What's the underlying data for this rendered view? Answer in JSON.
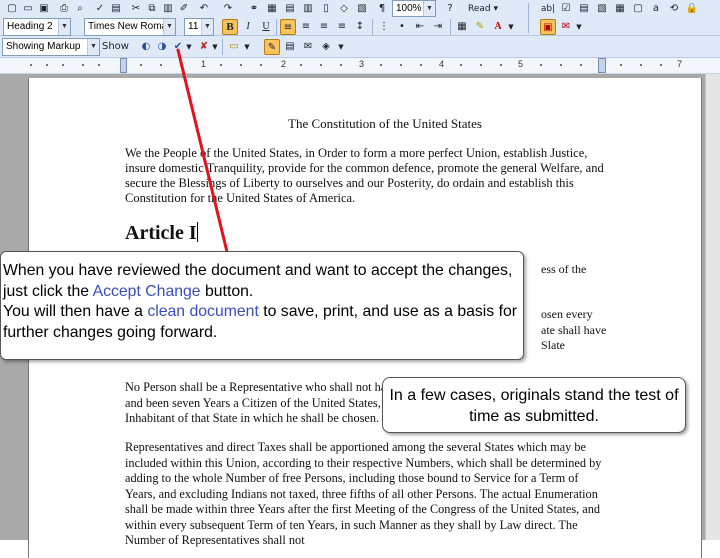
{
  "toolbar_format": {
    "style_value": "Heading 2",
    "font_value": "Times New Roman",
    "size_value": "11",
    "bold_label": "B",
    "italic_label": "I",
    "underline_label": "U",
    "zoom_value": "100%",
    "read_label": "Read"
  },
  "toolbar_reviewing": {
    "markup_value": "Showing Markup",
    "show_label": "Show"
  },
  "ruler": {
    "numbers": [
      "1",
      "2",
      "3",
      "4",
      "5",
      "7"
    ]
  },
  "document": {
    "title": "The Constitution of the United States",
    "preamble": "We the People of the United States, in Order to form a more perfect Union, establish Justice, insure domestic Tranquility, provide for the common defence, promote the general Welfare, and secure the Blessings of Liberty to ourselves and our Posterity, do ordain and establish this Constitution for the United States of America.",
    "article_heading": "Article I",
    "fragment_1": "ess of the",
    "fragment_2": "osen every",
    "fragment_3": "ate shall have",
    "fragment_4": "Slate",
    "para_qualifications": "No Person shall be a Representative who shall not have attained to the Age of twenty five Years, and been seven Years a Citizen of the United States, and who shall not, when elected, be an Inhabitant of that State in which he shall be chosen.",
    "para_apportionment": "Representatives and direct Taxes shall be apportioned among the several States which may be included within this Union, according to their respective Numbers, which shall be determined by adding to the whole Number of free Persons, including those bound to Service for a Term of Years, and excluding Indians not taxed, three fifths of all other Persons. The actual Enumeration shall be made within three Years after the first Meeting of the Congress of the United States, and within every subsequent Term of ten Years, in such Manner as they shall by Law direct. The Number of Representatives shall not"
  },
  "callout_main": {
    "part1": "When you have reviewed the document and want to accept the changes, just click the ",
    "highlight1": "Accept Change",
    "part2": " button.",
    "part3": "You will then have a ",
    "highlight2": "clean document",
    "part4": " to save, print, and use as a basis for further changes going forward."
  },
  "callout_small": {
    "text": "In a few cases, originals stand the test of time as submitted."
  },
  "colors": {
    "highlight": "#3b4dbb",
    "pointer_line": "#e0141e",
    "toolbar_bg": "#dfe9f7"
  }
}
